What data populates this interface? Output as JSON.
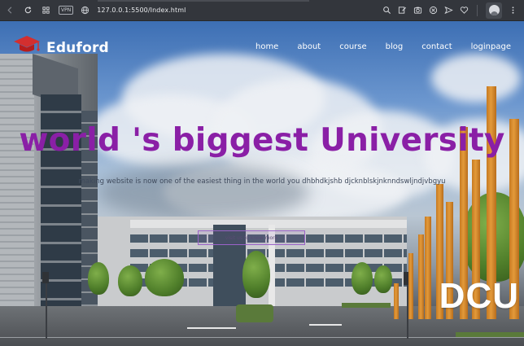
{
  "browser": {
    "vpn_label": "VPN",
    "url": "127.0.0.1:5500/Index.html",
    "icons": [
      "back-icon",
      "reload-icon",
      "tabs-grid-icon",
      "globe-icon",
      "search-icon",
      "edit-icon",
      "camera-icon",
      "close-circle-icon",
      "send-icon",
      "heart-icon",
      "avatar-icon"
    ]
  },
  "site": {
    "brand": "Eduford",
    "nav": [
      "home",
      "about",
      "course",
      "blog",
      "contact",
      "loginpage"
    ],
    "hero_title": "world 's biggest University",
    "hero_subtitle": "making website is now one of the easiest thing in the world you dhbhdkjshb djcknblskjnknndswljndjvbgyu",
    "cta_label": "visit us to know more",
    "sign_text": "DCU",
    "colors": {
      "title": "#8a1fa6",
      "logo_cap": "#d32f2f",
      "nav_text": "#ffffff"
    }
  }
}
